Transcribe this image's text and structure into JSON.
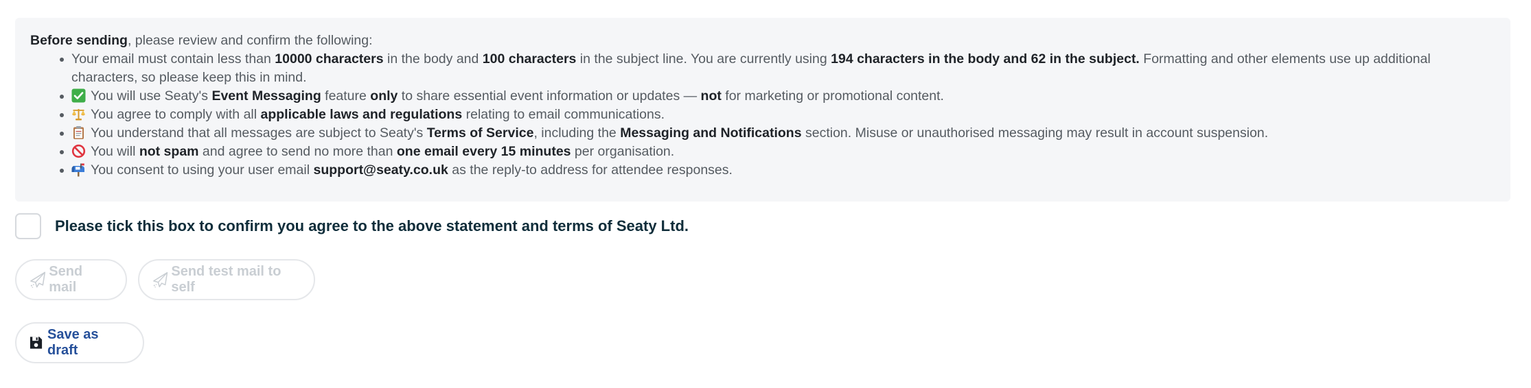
{
  "notice": {
    "intro_strong": "Before sending",
    "intro_rest": ", please review and confirm the following:",
    "item1": {
      "t1": "Your email must contain less than ",
      "b1": "10000 characters",
      "t2": " in the body and ",
      "b2": "100 characters",
      "t3": " in the subject line. You are currently using ",
      "b3": "194 characters in the body and 62 in the subject.",
      "t4": " Formatting and other elements use up additional characters, so please keep this in mind."
    },
    "item2": {
      "icon": "check-mark-icon",
      "t1": "You will use Seaty's ",
      "b1": "Event Messaging",
      "t2": " feature ",
      "b2": "only",
      "t3": " to share essential event information or updates — ",
      "b3": "not",
      "t4": " for marketing or promotional content."
    },
    "item3": {
      "icon": "scales-icon",
      "t1": "You agree to comply with all ",
      "b1": "applicable laws and regulations",
      "t2": " relating to email communications."
    },
    "item4": {
      "icon": "clipboard-icon",
      "t1": "You understand that all messages are subject to Seaty's ",
      "b1": "Terms of Service",
      "t2": ", including the ",
      "b2": "Messaging and Notifications",
      "t3": " section. Misuse or unauthorised messaging may result in account suspension."
    },
    "item5": {
      "icon": "prohibited-icon",
      "t1": "You will ",
      "b1": "not spam",
      "t2": " and agree to send no more than ",
      "b2": "one email every 15 minutes",
      "t3": " per organisation."
    },
    "item6": {
      "icon": "mailbox-icon",
      "t1": "You consent to using your user email ",
      "b1": "support@seaty.co.uk",
      "t2": " as the reply-to address for attendee responses."
    }
  },
  "confirm": {
    "label": "Please tick this box to confirm you agree to the above statement and terms of Seaty Ltd.",
    "checked": false
  },
  "buttons": {
    "send_mail": "Send mail",
    "send_test": "Send test mail to self",
    "save_draft": "Save as draft"
  },
  "colors": {
    "notice_bg": "#f5f6f8",
    "primary": "#26509a",
    "disabled": "#c9ced3",
    "heading": "#0f2d3a"
  }
}
